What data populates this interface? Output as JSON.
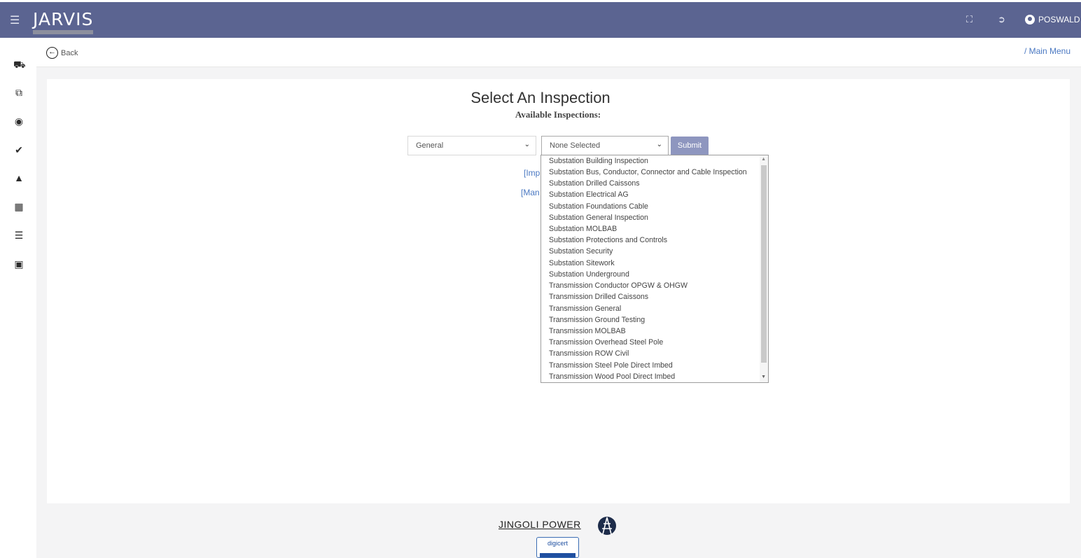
{
  "header": {
    "app_name": "JARVIS",
    "user_name": "POSWALD",
    "fullscreen_icon": "fullscreen-icon",
    "logout_icon": "logout-icon"
  },
  "sidebar": {
    "icons": [
      "truck-icon",
      "copy-icon",
      "lifebuoy-icon",
      "check-icon",
      "lock-icon",
      "table-icon",
      "list-icon",
      "id-card-icon"
    ]
  },
  "nav": {
    "back_label": "Back",
    "breadcrumb": "/ Main Menu"
  },
  "page": {
    "title": "Select An Inspection",
    "subtitle": "Available Inspections:"
  },
  "form": {
    "category_value": "General",
    "inspection_value": "None Selected",
    "submit_label": "Submit"
  },
  "links": {
    "link1_partial": "[Imp",
    "link2_partial": "[Man"
  },
  "dropdown": {
    "options": [
      "Substation Building Inspection",
      "Substation Bus, Conductor, Connector and Cable Inspection",
      "Substation Drilled Caissons",
      "Substation Electrical AG",
      "Substation Foundations Cable",
      "Substation General Inspection",
      "Substation MOLBAB",
      "Substation Protections and Controls",
      "Substation Security",
      "Substation Sitework",
      "Substation Underground",
      "Transmission Conductor OPGW & OHGW",
      "Transmission Drilled Caissons",
      "Transmission General",
      "Transmission Ground Testing",
      "Transmission MOLBAB",
      "Transmission Overhead Steel Pole",
      "Transmission ROW Civil",
      "Transmission Steel Pole Direct Imbed",
      "Transmission Wood Pool Direct Imbed"
    ]
  },
  "footer": {
    "company": "JINGOLI POWER",
    "badge": "digicert"
  },
  "colors": {
    "topbar": "#5b6491",
    "submit": "#8e96bf",
    "link": "#4a78c2"
  }
}
